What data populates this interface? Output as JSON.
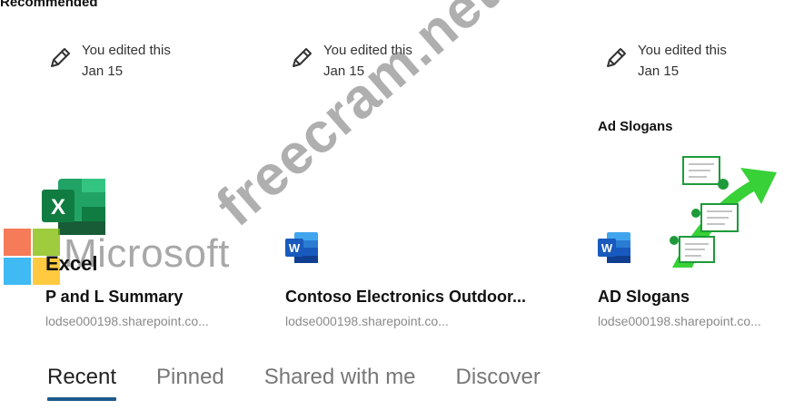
{
  "section": {
    "title": "Recommended"
  },
  "cards": [
    {
      "edited_line1": "You edited this",
      "edited_line2": "Jan 15",
      "app_label": "Excel",
      "name": "P and L Summary",
      "url": "lodse000198.sharepoint.co..."
    },
    {
      "edited_line1": "You edited this",
      "edited_line2": "Jan 15",
      "name": "Contoso Electronics Outdoor...",
      "url": "lodse000198.sharepoint.co..."
    },
    {
      "edited_line1": "You edited this",
      "edited_line2": "Jan 15",
      "preview_title": "Ad Slogans",
      "name": "AD Slogans",
      "url": "lodse000198.sharepoint.co..."
    }
  ],
  "tabs": [
    "Recent",
    "Pinned",
    "Shared with me",
    "Discover"
  ],
  "overlay": {
    "microsoft_text": "Microsoft",
    "watermark": "freecram.net"
  },
  "colors": {
    "excel_green": "#1e7145",
    "word_blue": "#2b579a",
    "tab_underline": "#1f5a8a",
    "arrow_green": "#22cc22"
  },
  "icons": [
    "edit-pencil-icon",
    "excel-icon",
    "word-icon"
  ]
}
